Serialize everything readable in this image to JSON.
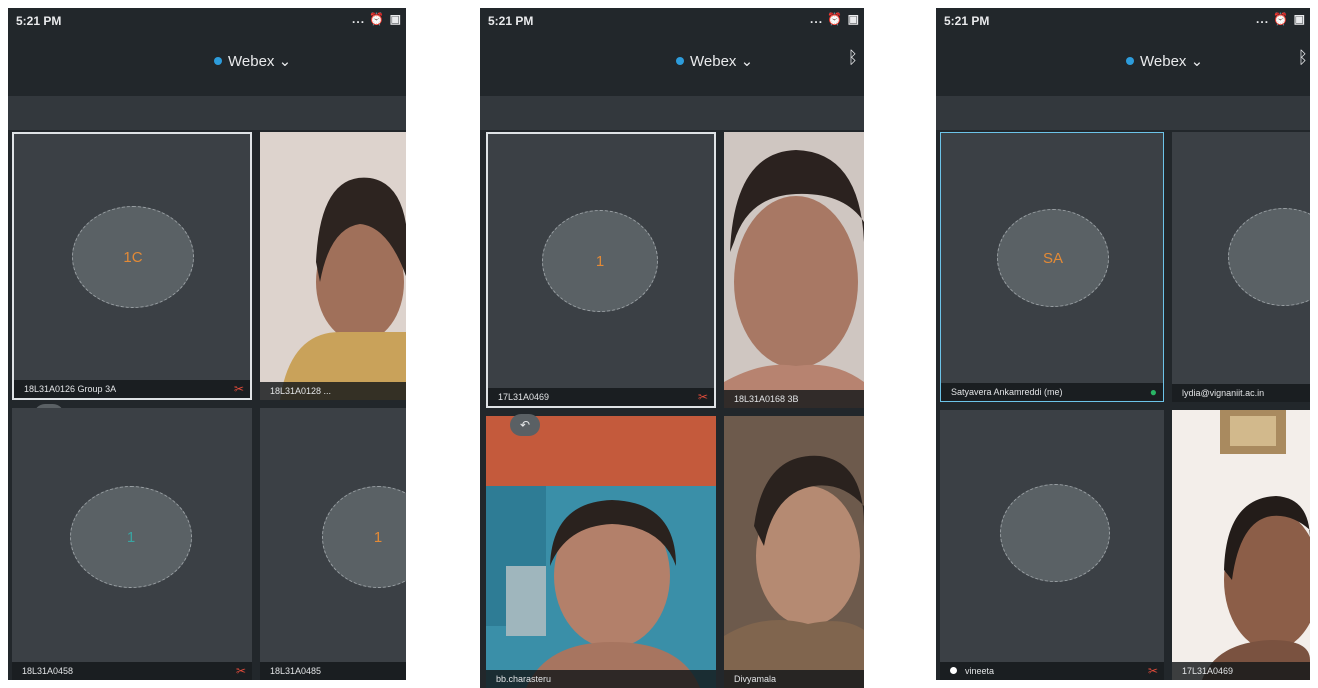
{
  "screens": [
    {
      "time": "5:21 PM",
      "status_icons": "... ⏰ ▣",
      "app_title": "Webex",
      "tiles": [
        {
          "avatar": "1C",
          "name": "18L31A0126 Group 3A",
          "mic": "muted"
        },
        {
          "name": "18L31A0128 ...",
          "video": true
        },
        {
          "avatar": "1",
          "name": "18L31A0458",
          "mic": "muted"
        },
        {
          "avatar": "1",
          "name": "18L31A0485"
        }
      ]
    },
    {
      "time": "5:21 PM",
      "status_icons": "... ⏰ ▣",
      "app_title": "Webex",
      "tiles": [
        {
          "avatar": "1",
          "name": "17L31A0469",
          "mic": "muted"
        },
        {
          "name": "18L31A0168 3B",
          "video": true
        },
        {
          "name": "bb.charasteru",
          "video": true
        },
        {
          "name": "Divyamala",
          "video": true
        }
      ]
    },
    {
      "time": "5:21 PM",
      "status_icons": "... ⏰ ▣",
      "app_title": "Webex",
      "tiles": [
        {
          "avatar": "SA",
          "name": "Satyavera Ankamreddi (me)",
          "mic": "active"
        },
        {
          "avatar": "",
          "name": "lydia@vignaniit.ac.in"
        },
        {
          "avatar": "",
          "name": "vineeta",
          "mic": "muted"
        },
        {
          "name": "17L31A0469",
          "video": true
        }
      ]
    }
  ],
  "icons": {
    "bluetooth": "bluetooth-icon",
    "back": "back-arrow-icon",
    "mic_muted": "mic-muted-icon",
    "mic_active": "mic-active-icon",
    "chat": "chat-icon"
  },
  "colors": {
    "background": "#22272b",
    "tile": "#3b4045",
    "webex_dot": "#2d9cdb",
    "avatar_text_orange": "#e38a36",
    "avatar_text_teal": "#3aa4a1"
  }
}
